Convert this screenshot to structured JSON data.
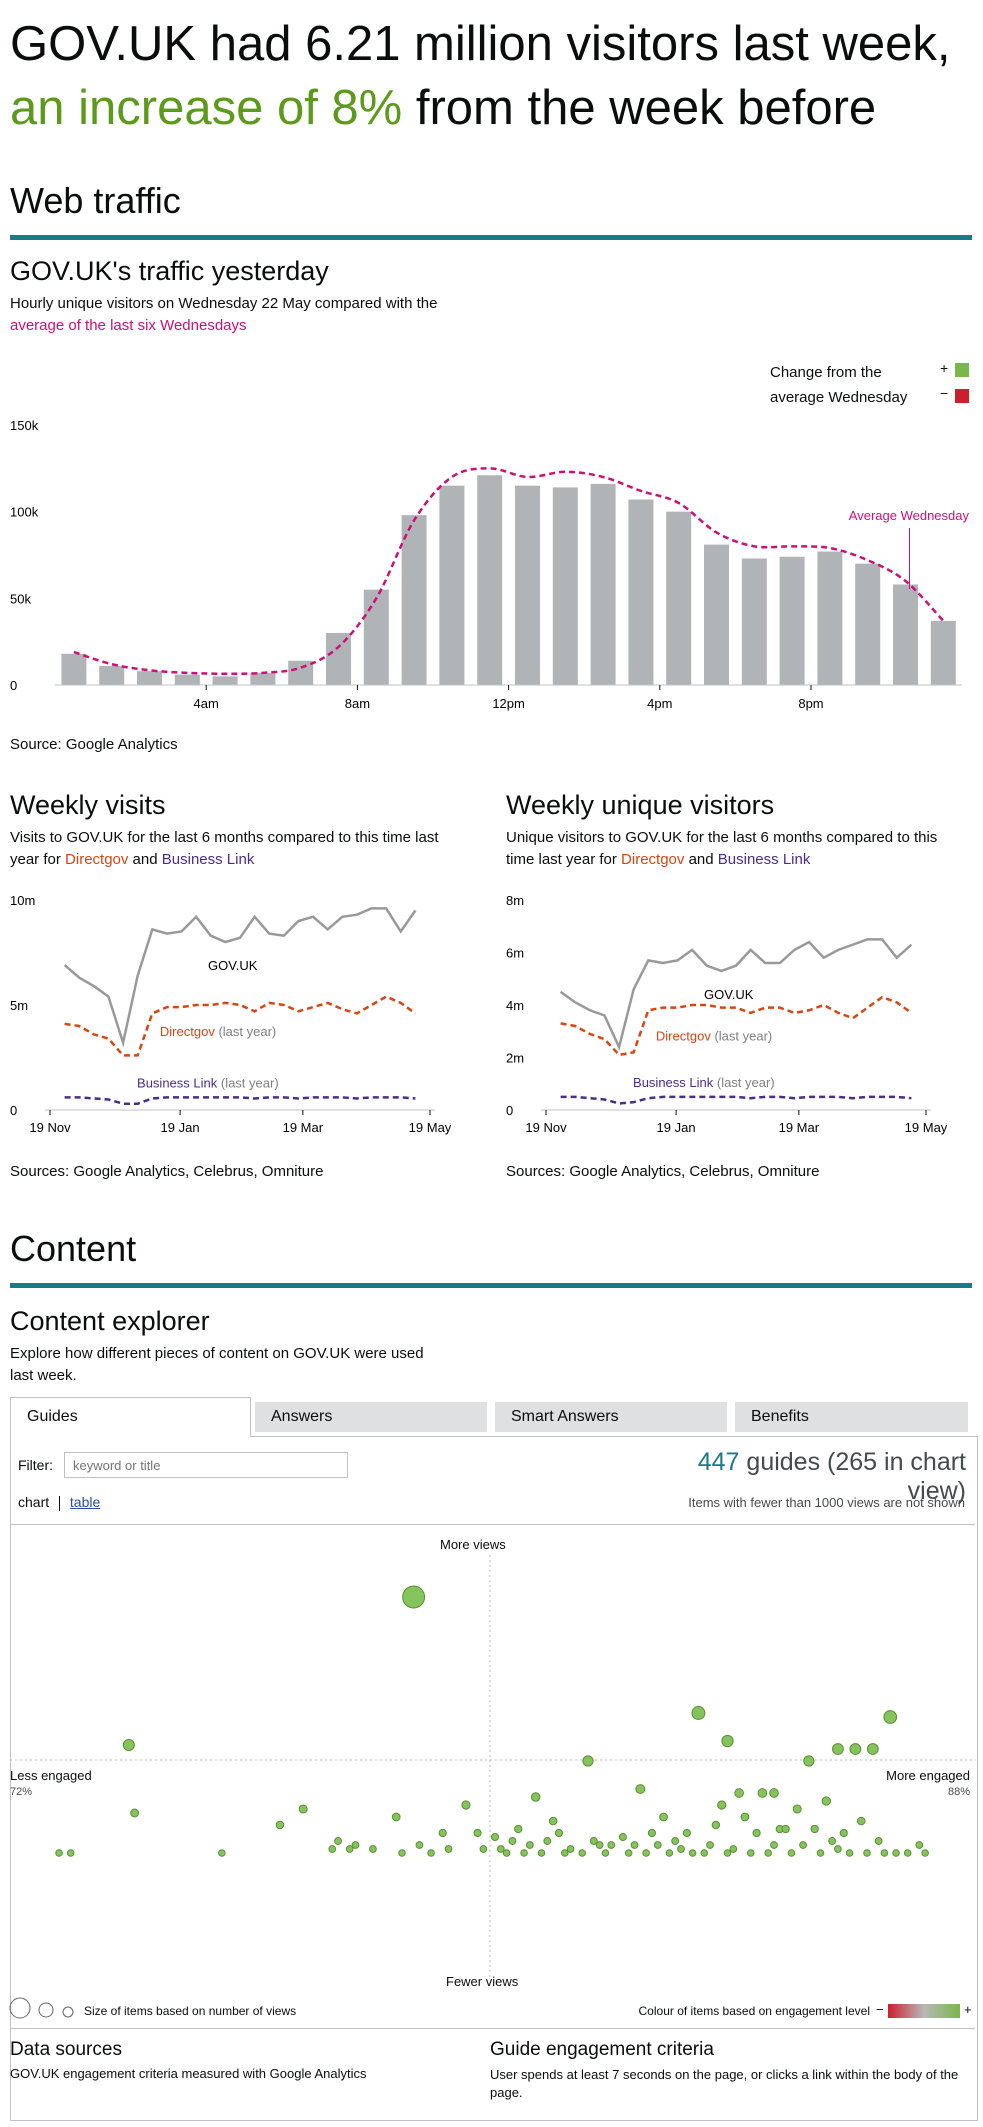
{
  "headline": {
    "part1": "GOV.UK had 6.21 million visitors last week,",
    "highlight": "an increase of 8%",
    "part2": " from the week before"
  },
  "web_traffic": {
    "section_title": "Web traffic",
    "hourly": {
      "title": "GOV.UK's traffic yesterday",
      "desc_plain": "Hourly unique visitors on Wednesday 22 May compared with the",
      "desc_link": "average of the last six Wednesdays",
      "legend_line1": "Change from the",
      "legend_line2": "average Wednesday",
      "legend_plus": "+",
      "legend_minus": "−",
      "annotation": "Average Wednesday",
      "source": "Source: Google Analytics"
    },
    "visits": {
      "title": "Weekly visits",
      "desc_plain": "Visits to GOV.UK for the last 6 months compared to this time last year for ",
      "desc_directgov": "Directgov",
      "desc_and": " and ",
      "desc_bl": "Business Link",
      "source": "Sources: Google Analytics, Celebrus, Omniture"
    },
    "visitors": {
      "title": "Weekly unique visitors",
      "desc_plain": "Unique visitors to GOV.UK for the last 6 months compared to this time last year for ",
      "desc_directgov": "Directgov",
      "desc_and": " and ",
      "desc_bl": "Business Link",
      "source": "Sources: Google Analytics, Celebrus, Omniture"
    }
  },
  "content": {
    "section_title": "Content",
    "explorer_title": "Content explorer",
    "explorer_desc": "Explore how different pieces of content on GOV.UK were used last week.",
    "tabs": [
      "Guides",
      "Answers",
      "Smart Answers",
      "Benefits"
    ],
    "filter_label": "Filter:",
    "filter_placeholder": "keyword or title",
    "count_number": "447",
    "count_text": " guides (265 in chart view)",
    "view_chart": "chart",
    "view_table": "table",
    "note": "Items with fewer than 1000 views are not shown",
    "label_more_views": "More views",
    "label_fewer_views": "Fewer views",
    "label_less_engaged": "Less engaged",
    "label_more_engaged": "More engaged",
    "label_min_pct": "72%",
    "label_max_pct": "88%",
    "size_legend": "Size of items based on number of views",
    "colour_legend": "Colour of items based on engagement level",
    "colour_minus": "−",
    "colour_plus": "+",
    "data_sources_title": "Data sources",
    "data_sources_text": "GOV.UK engagement criteria measured with Google Analytics",
    "criteria_title": "Guide engagement criteria",
    "criteria_text": "User spends at least 7 seconds on the page, or clicks a link within the body of the page."
  },
  "colors": {
    "accent_rule": "#1a7a8c",
    "headline_green": "#5c9a1b",
    "bar_grey": "#b1b4b6",
    "average_pink": "#cc0f7a",
    "legend_increase": "#78b84a",
    "legend_decrease": "#cc1f2d",
    "govuk_line": "#999999",
    "directgov": "#d9440f",
    "business_link": "#4b2c8b",
    "bubble_fill": "#85c45c",
    "bubble_stroke": "#5a8f32",
    "count_blue": "#1a7a8c"
  },
  "chart_data": [
    {
      "type": "bar",
      "title": "GOV.UK's traffic yesterday",
      "categories": [
        "0",
        "1",
        "2",
        "3",
        "4",
        "5",
        "6",
        "7",
        "8",
        "9",
        "10",
        "11",
        "12",
        "13",
        "14",
        "15",
        "16",
        "17",
        "18",
        "19",
        "20",
        "21",
        "22",
        "23"
      ],
      "x_tick_labels": [
        "4am",
        "8am",
        "12pm",
        "4pm",
        "8pm"
      ],
      "x_tick_hours": [
        4,
        8,
        12,
        16,
        20
      ],
      "y_tick_labels": [
        "0",
        "50k",
        "100k",
        "150k"
      ],
      "y_ticks": [
        0,
        50000,
        100000,
        150000
      ],
      "ylim": [
        0,
        150000
      ],
      "series": [
        {
          "name": "",
          "type": "bar",
          "values": [
            18000,
            11000,
            8000,
            6000,
            5000,
            7000,
            14000,
            30000,
            55000,
            98000,
            115000,
            121000,
            115000,
            114000,
            116000,
            107000,
            100000,
            81000,
            73000,
            74000,
            77000,
            70000,
            58000,
            37000
          ]
        },
        {
          "name": "Average Wednesday",
          "type": "line",
          "values": [
            19000,
            12000,
            8500,
            7000,
            6500,
            7000,
            10000,
            22000,
            50000,
            95000,
            120000,
            125000,
            120000,
            123000,
            120000,
            112000,
            105000,
            88000,
            80000,
            80000,
            79000,
            72000,
            60000,
            37000
          ]
        }
      ]
    },
    {
      "type": "line",
      "title": "Weekly visits",
      "x_tick_labels": [
        "19 Nov",
        "19 Jan",
        "19 Mar",
        "19 May"
      ],
      "x_tick_weeks": [
        0,
        8.9,
        17.3,
        26
      ],
      "y_tick_labels": [
        "0",
        "5m",
        "10m"
      ],
      "y_ticks": [
        0,
        5000000,
        10000000
      ],
      "ylim": [
        0,
        10000000
      ],
      "series": [
        {
          "name": "GOV.UK",
          "values": [
            6900000,
            6300000,
            5900000,
            5400000,
            3200000,
            6400000,
            8600000,
            8400000,
            8500000,
            9200000,
            8300000,
            8000000,
            8200000,
            9200000,
            8400000,
            8300000,
            9000000,
            9200000,
            8600000,
            9200000,
            9300000,
            9600000,
            9600000,
            8500000,
            9500000
          ]
        },
        {
          "name": "Directgov (last year)",
          "values": [
            4100000,
            4000000,
            3600000,
            3400000,
            2600000,
            2600000,
            4600000,
            4900000,
            4900000,
            5000000,
            5000000,
            5100000,
            5000000,
            4700000,
            5100000,
            5000000,
            4700000,
            4900000,
            5100000,
            4800000,
            4600000,
            5000000,
            5400000,
            5100000,
            4600000
          ]
        },
        {
          "name": "Business Link (last year)",
          "values": [
            600000,
            600000,
            550000,
            500000,
            300000,
            300000,
            550000,
            600000,
            600000,
            600000,
            600000,
            600000,
            600000,
            550000,
            600000,
            600000,
            550000,
            600000,
            600000,
            600000,
            550000,
            600000,
            600000,
            600000,
            550000
          ]
        }
      ]
    },
    {
      "type": "line",
      "title": "Weekly unique visitors",
      "x_tick_labels": [
        "19 Nov",
        "19 Jan",
        "19 Mar",
        "19 May"
      ],
      "x_tick_weeks": [
        0,
        8.9,
        17.3,
        26
      ],
      "y_tick_labels": [
        "0",
        "2m",
        "4m",
        "6m",
        "8m"
      ],
      "y_ticks": [
        0,
        2000000,
        4000000,
        6000000,
        8000000
      ],
      "ylim": [
        0,
        8000000
      ],
      "series": [
        {
          "name": "GOV.UK",
          "values": [
            4500000,
            4100000,
            3800000,
            3600000,
            2400000,
            4600000,
            5700000,
            5600000,
            5700000,
            6100000,
            5500000,
            5300000,
            5500000,
            6100000,
            5600000,
            5600000,
            6100000,
            6400000,
            5800000,
            6100000,
            6300000,
            6500000,
            6500000,
            5800000,
            6300000
          ]
        },
        {
          "name": "Directgov (last year)",
          "values": [
            3300000,
            3200000,
            2900000,
            2700000,
            2100000,
            2200000,
            3800000,
            3900000,
            3900000,
            4000000,
            4000000,
            3900000,
            3900000,
            3700000,
            3900000,
            3900000,
            3700000,
            3800000,
            4000000,
            3700000,
            3500000,
            3900000,
            4300000,
            4100000,
            3700000
          ]
        },
        {
          "name": "Business Link (last year)",
          "values": [
            500000,
            500000,
            450000,
            400000,
            250000,
            300000,
            450000,
            500000,
            500000,
            500000,
            500000,
            500000,
            500000,
            450000,
            500000,
            500000,
            450000,
            500000,
            500000,
            500000,
            450000,
            500000,
            500000,
            500000,
            450000
          ]
        }
      ]
    },
    {
      "type": "scatter",
      "title": "Content explorer",
      "xlabel_left": "Less engaged",
      "xlabel_right": "More engaged",
      "ylabel_top": "More views",
      "ylabel_bottom": "Fewer views",
      "xlim": [
        72,
        88
      ],
      "x_unit": "engagement %",
      "y_unit": "relative views (0 = fewest, 1 = most)",
      "points": [
        [
          78.6,
          0.92
        ],
        [
          73.7,
          0.55
        ],
        [
          83.5,
          0.63
        ],
        [
          86.8,
          0.62
        ],
        [
          84.0,
          0.56
        ],
        [
          85.9,
          0.54
        ],
        [
          86.2,
          0.54
        ],
        [
          86.5,
          0.54
        ],
        [
          85.4,
          0.51
        ],
        [
          81.6,
          0.51
        ],
        [
          82.5,
          0.44
        ],
        [
          84.6,
          0.43
        ],
        [
          84.2,
          0.43
        ],
        [
          84.8,
          0.43
        ],
        [
          80.7,
          0.42
        ],
        [
          83.9,
          0.4
        ],
        [
          85.2,
          0.39
        ],
        [
          85.7,
          0.41
        ],
        [
          79.5,
          0.4
        ],
        [
          81.0,
          0.36
        ],
        [
          83.8,
          0.35
        ],
        [
          84.3,
          0.37
        ],
        [
          82.9,
          0.37
        ],
        [
          84.9,
          0.34
        ],
        [
          85.5,
          0.34
        ],
        [
          86.3,
          0.36
        ],
        [
          76.7,
          0.39
        ],
        [
          79.7,
          0.33
        ],
        [
          80.3,
          0.31
        ],
        [
          82.2,
          0.32
        ],
        [
          81.7,
          0.31
        ],
        [
          78.3,
          0.37
        ],
        [
          73.8,
          0.38
        ],
        [
          76.3,
          0.35
        ],
        [
          79.1,
          0.33
        ],
        [
          80.4,
          0.34
        ],
        [
          82.7,
          0.33
        ],
        [
          83.3,
          0.33
        ],
        [
          84.5,
          0.33
        ],
        [
          85.0,
          0.34
        ],
        [
          86.0,
          0.33
        ],
        [
          83.7,
          0.3
        ],
        [
          80.9,
          0.31
        ],
        [
          81.1,
          0.33
        ],
        [
          82.0,
          0.3
        ],
        [
          84.1,
          0.29
        ],
        [
          85.8,
          0.31
        ],
        [
          86.6,
          0.31
        ],
        [
          72.5,
          0.28
        ],
        [
          72.7,
          0.28
        ],
        [
          75.3,
          0.28
        ],
        [
          77.2,
          0.29
        ],
        [
          77.5,
          0.29
        ],
        [
          77.9,
          0.29
        ],
        [
          78.4,
          0.28
        ],
        [
          78.9,
          0.28
        ],
        [
          79.2,
          0.29
        ],
        [
          80.2,
          0.28
        ],
        [
          80.5,
          0.28
        ],
        [
          80.8,
          0.28
        ],
        [
          81.2,
          0.28
        ],
        [
          81.5,
          0.28
        ],
        [
          81.9,
          0.28
        ],
        [
          82.3,
          0.28
        ],
        [
          82.6,
          0.28
        ],
        [
          83.0,
          0.28
        ],
        [
          83.4,
          0.28
        ],
        [
          83.6,
          0.28
        ],
        [
          84.0,
          0.28
        ],
        [
          84.4,
          0.28
        ],
        [
          84.7,
          0.28
        ],
        [
          85.1,
          0.28
        ],
        [
          85.6,
          0.28
        ],
        [
          86.1,
          0.28
        ],
        [
          86.4,
          0.28
        ],
        [
          86.7,
          0.28
        ],
        [
          86.9,
          0.28
        ],
        [
          87.1,
          0.28
        ],
        [
          87.4,
          0.28
        ],
        [
          87.3,
          0.3
        ],
        [
          81.3,
          0.29
        ],
        [
          82.8,
          0.3
        ],
        [
          83.1,
          0.31
        ],
        [
          83.2,
          0.29
        ],
        [
          84.8,
          0.3
        ],
        [
          85.3,
          0.3
        ],
        [
          85.9,
          0.29
        ],
        [
          80.6,
          0.3
        ],
        [
          81.8,
          0.3
        ],
        [
          82.4,
          0.3
        ],
        [
          80.1,
          0.29
        ],
        [
          79.8,
          0.29
        ],
        [
          78.7,
          0.3
        ],
        [
          77.6,
          0.3
        ],
        [
          77.3,
          0.31
        ],
        [
          80.0,
          0.32
        ]
      ]
    }
  ]
}
